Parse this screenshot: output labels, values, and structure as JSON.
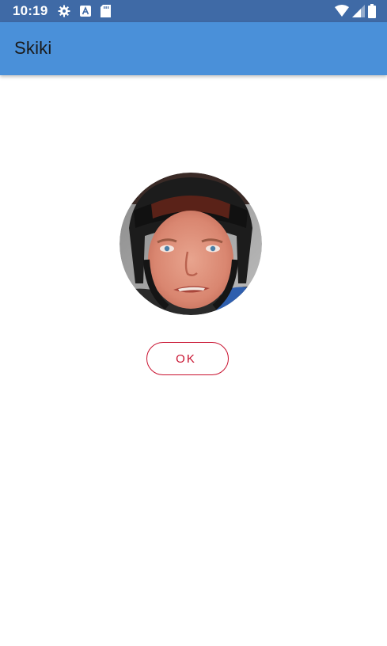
{
  "status_bar": {
    "time": "10:19",
    "left_icons": [
      "settings-icon",
      "a-badge-icon",
      "sd-card-icon"
    ],
    "right_icons": [
      "wifi-icon",
      "cell-signal-icon",
      "battery-icon"
    ]
  },
  "app_bar": {
    "title": "Skiki"
  },
  "content": {
    "avatar": "skier-portrait",
    "ok_label": "OK"
  },
  "colors": {
    "status_bar": "#3f6aa6",
    "app_bar": "#4a90d9",
    "accent": "#c8102e",
    "background": "#ffffff"
  }
}
